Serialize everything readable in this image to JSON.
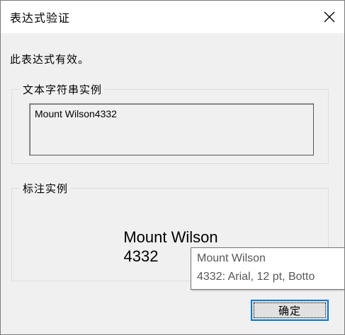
{
  "window": {
    "title": "表达式验证"
  },
  "message": "此表达式有效。",
  "text_sample": {
    "group_label": "文本字符串实例",
    "value": "Mount Wilson4332"
  },
  "label_sample": {
    "group_label": "标注实例",
    "line1": "Mount Wilson",
    "line2": "4332"
  },
  "tooltip": {
    "line1": "Mount Wilson",
    "line2": "4332:  Arial, 12 pt, Botto"
  },
  "buttons": {
    "ok_label": "确定"
  },
  "icons": {
    "close": "close-icon"
  },
  "colors": {
    "focus_border": "#0078d7",
    "dialog_background": "#f0f0f0"
  }
}
